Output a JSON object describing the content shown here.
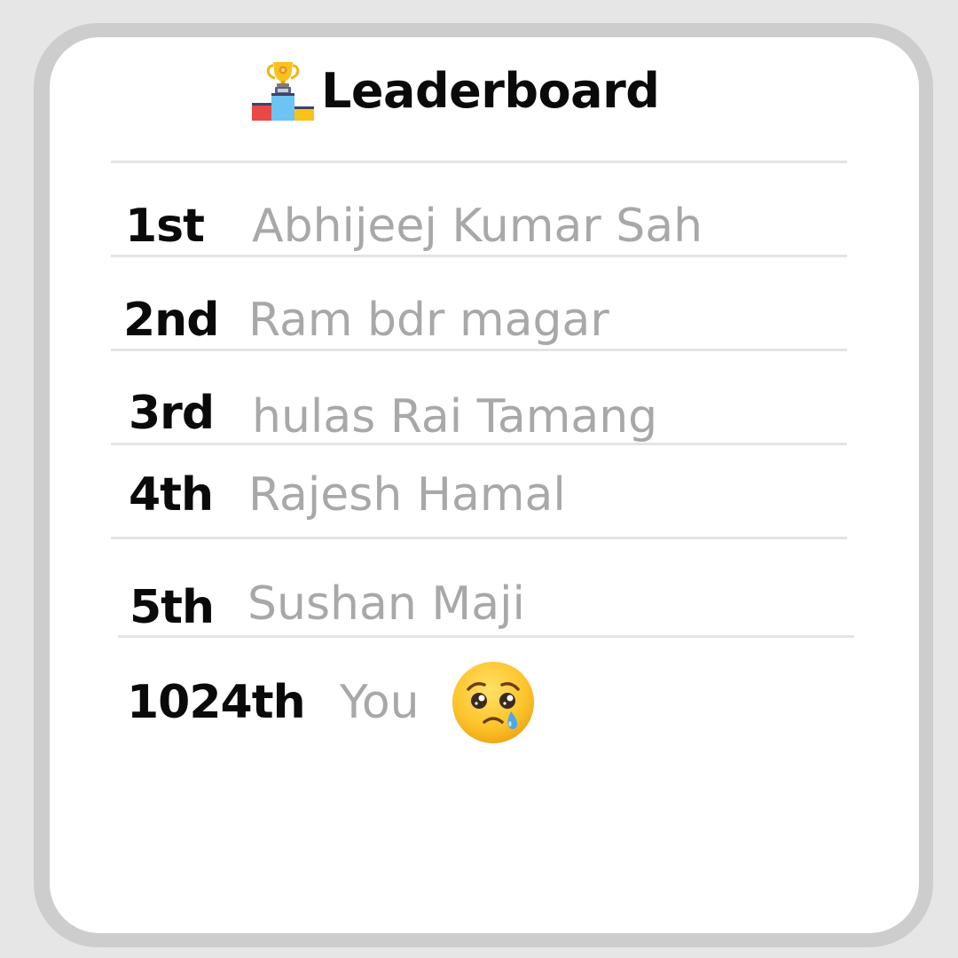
{
  "leaderboard": {
    "title": "Leaderboard",
    "title_icon": "podium-trophy-icon",
    "entries": [
      {
        "rank": "1st",
        "name": "Abhijeej Kumar Sah"
      },
      {
        "rank": "2nd",
        "name": "Ram bdr magar"
      },
      {
        "rank": "3rd",
        "name": "hulas Rai Tamang"
      },
      {
        "rank": "4th",
        "name": "Rajesh Hamal"
      },
      {
        "rank": "5th",
        "name": "Sushan Maji"
      }
    ],
    "you": {
      "rank": "1024th",
      "name": "You",
      "icon": "sad-tear-face-icon"
    }
  },
  "colors": {
    "page_background": "#e6e6e6",
    "frame": "#cdcdcd",
    "card": "#ffffff",
    "rank_text": "#0a0a0a",
    "name_text": "#a8a8a8",
    "divider": "#e4e4e4"
  }
}
